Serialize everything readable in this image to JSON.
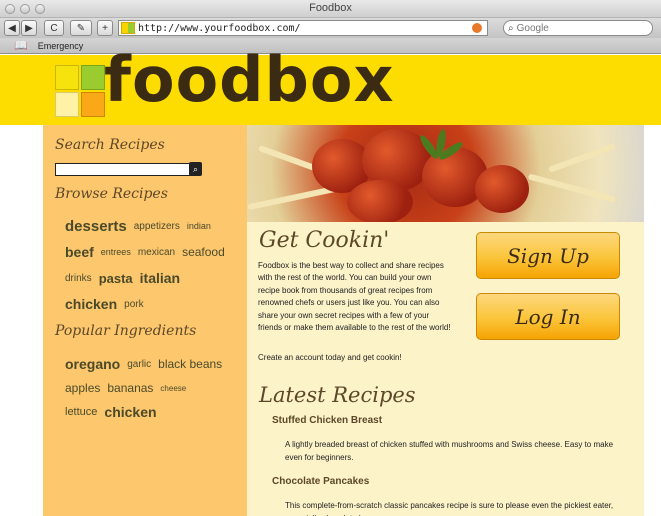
{
  "browser": {
    "window_title": "Foodbox",
    "url": "http://www.yourfoodbox.com/",
    "search_placeholder": "Google",
    "bookmark": "Emergency",
    "reload_label": "C",
    "add_label": "+"
  },
  "header": {
    "logo_text": "foodbox",
    "logo_colors": [
      "#f6e20c",
      "#9bcc2f",
      "#fff2a6",
      "#f9a917"
    ]
  },
  "sidebar": {
    "search_title": "Search Recipes",
    "browse_title": "Browse Recipes",
    "browse_lines": [
      [
        {
          "t": "desserts",
          "s": 15,
          "b": true
        },
        {
          "t": "appetizers",
          "s": 10
        },
        {
          "t": "indian",
          "s": 9
        }
      ],
      [
        {
          "t": "beef",
          "s": 14,
          "b": true
        },
        {
          "t": "entrees",
          "s": 9
        },
        {
          "t": "mexican",
          "s": 10
        },
        {
          "t": "seafood",
          "s": 12
        }
      ],
      [
        {
          "t": "drinks",
          "s": 10
        },
        {
          "t": "pasta",
          "s": 13,
          "b": true
        },
        {
          "t": "italian",
          "s": 14,
          "b": true
        }
      ],
      [
        {
          "t": "chicken",
          "s": 14,
          "b": true
        },
        {
          "t": "pork",
          "s": 10
        }
      ]
    ],
    "ingredients_title": "Popular Ingredients",
    "ingredient_lines": [
      [
        {
          "t": "oregano",
          "s": 14,
          "b": true
        },
        {
          "t": "garlic",
          "s": 10
        },
        {
          "t": "black beans",
          "s": 12
        }
      ],
      [
        {
          "t": "apples",
          "s": 12
        },
        {
          "t": "bananas",
          "s": 12
        },
        {
          "t": "cheese",
          "s": 8
        }
      ],
      [
        {
          "t": "lettuce",
          "s": 11
        },
        {
          "t": "chicken",
          "s": 14,
          "b": true
        }
      ]
    ]
  },
  "main": {
    "heading": "Get Cookin'",
    "intro": "Foodbox is the best way to collect and share recipes with the rest of the world. You can build your own recipe book from thousands of great recipes from renowned chefs or users just like you. You can also share your own secret recipes with a few of your friends or make them available to the rest of the world!",
    "cta": "Create an account today and get cookin!",
    "signup_label": "Sign Up",
    "login_label": "Log In",
    "latest_title": "Latest Recipes",
    "recipes": [
      {
        "title": "Stuffed Chicken Breast",
        "desc": "A lightly breaded breast of chicken stuffed with mushrooms and Swiss cheese. Easy to make even for beginners."
      },
      {
        "title": "Chocolate Pancakes",
        "desc": "This complete-from-scratch classic pancakes recipe is sure to please even the pickiest eater, especially chocolate lovers."
      }
    ]
  }
}
